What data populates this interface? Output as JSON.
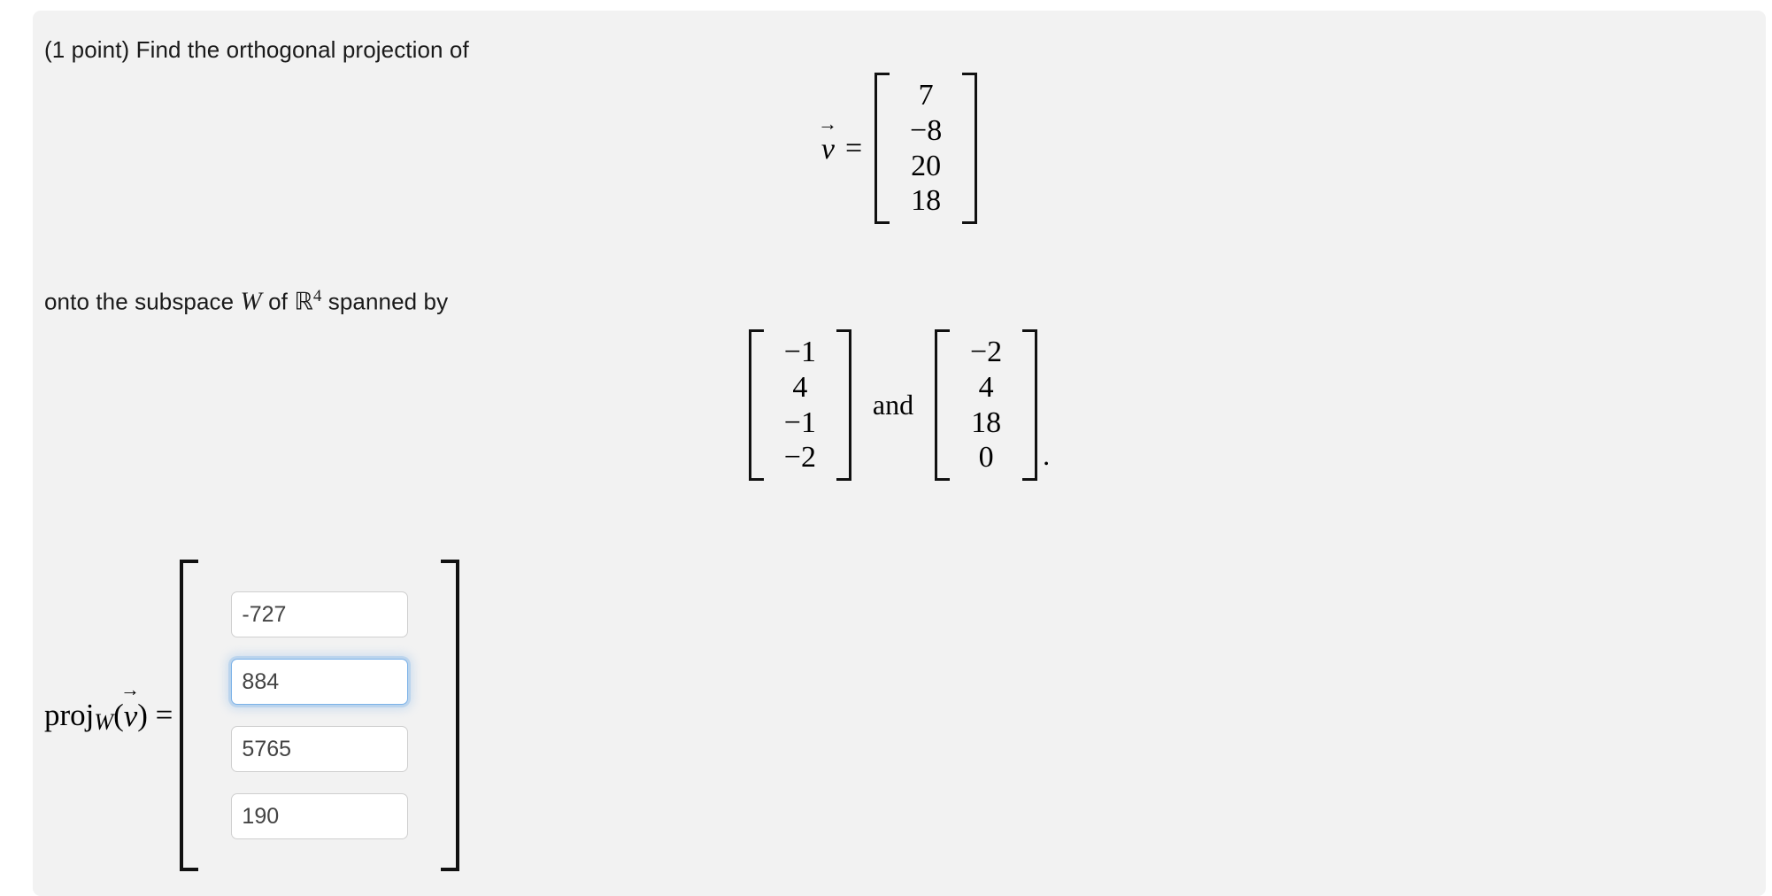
{
  "problem": {
    "points_label": "(1 point) Find the orthogonal projection of",
    "subspace_text_before": "onto the subspace",
    "subspace_symbol": "W",
    "subspace_text_of": "of",
    "field_symbol": "ℝ",
    "field_exponent": "4",
    "subspace_text_after": "spanned by",
    "and_word": "and",
    "trailing_period": "."
  },
  "vector_v": {
    "label_variable": "v",
    "equals": "=",
    "entries": [
      "7",
      "−8",
      "20",
      "18"
    ]
  },
  "spanning_vectors": [
    {
      "entries": [
        "−1",
        "4",
        "−1",
        "−2"
      ]
    },
    {
      "entries": [
        "−2",
        "4",
        "18",
        "0"
      ]
    }
  ],
  "answer": {
    "label_proj": "proj",
    "label_subscript": "W",
    "label_open_paren": "(",
    "label_variable": "v",
    "label_close_paren": ")",
    "label_equals": "=",
    "fields": [
      {
        "name": "component-1",
        "value": "-727",
        "focused": false
      },
      {
        "name": "component-2",
        "value": "884",
        "focused": true
      },
      {
        "name": "component-3",
        "value": "5765",
        "focused": false
      },
      {
        "name": "component-4",
        "value": "190",
        "focused": false
      }
    ]
  },
  "colors": {
    "card_background": "#f2f2f2",
    "page_background": "#ffffff",
    "text": "#1a1a1a",
    "input_text": "#444444",
    "input_border": "#cfcfcf",
    "focus_border": "#7cb2e8"
  }
}
